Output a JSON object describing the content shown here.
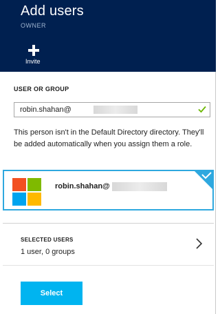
{
  "header": {
    "title": "Add users",
    "subtitle": "OWNER",
    "invite_label": "Invite"
  },
  "search": {
    "label": "USER OR GROUP",
    "value": "robin.shahan@"
  },
  "info_message": "This person isn't in the Default Directory directory. They'll be added automatically when you assign them a role.",
  "result": {
    "name": "robin.shahan@",
    "selected": true
  },
  "selected_users": {
    "label": "SELECTED USERS",
    "summary": "1 user, 0 groups"
  },
  "footer": {
    "select_label": "Select"
  },
  "colors": {
    "header_bg": "#002050",
    "accent": "#2ea8df",
    "button": "#00b4f0",
    "check_green": "#6bb700",
    "logo": [
      "#f25022",
      "#7fba00",
      "#00a4ef",
      "#ffb900"
    ]
  },
  "icons": {
    "invite": "plus-icon",
    "search_valid": "checkmark-icon",
    "result_selected": "checkmark-icon",
    "org_logo": "microsoft-logo",
    "navigate": "chevron-right-icon"
  }
}
